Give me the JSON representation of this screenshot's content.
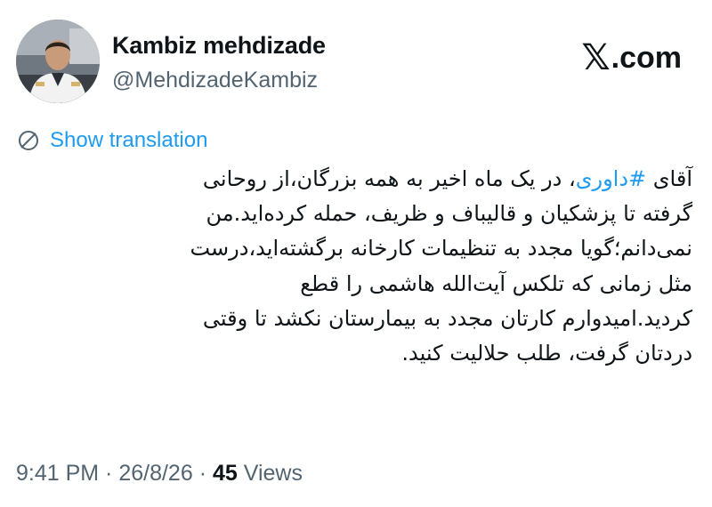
{
  "author": {
    "display_name": "Kambiz mehdizade",
    "handle": "@MehdizadeKambiz"
  },
  "brand": {
    "icon": "x-logo-icon",
    "suffix": ".com"
  },
  "translation": {
    "icon": "globe-translate-icon",
    "label": "Show translation"
  },
  "tweet": {
    "lines": [
      {
        "pre": "آقای ",
        "hashtag": "#داوری",
        "post": "، در یک ماه اخیر به همه بزرگان،از روحانی"
      },
      {
        "text": "گرفته تا پزشکیان و قالیباف و ظریف، حمله کرده‌اید.من"
      },
      {
        "text": "نمی‌دانم؛گویا مجدد به تنظیمات کارخانه برگشته‌اید،درست"
      },
      {
        "text": "مثل زمانی که تلکس آیت‌الله هاشمی را قطع"
      },
      {
        "text": "کردید.امیدوارم کارتان مجدد به بیمارستان نکشد تا وقتی"
      },
      {
        "text": "دردتان گرفت، طلب حلالیت کنید."
      }
    ]
  },
  "meta": {
    "time": "9:41 PM",
    "separator": " · ",
    "date": "26/8/26",
    "views_count": "45",
    "views_label": " Views"
  },
  "colors": {
    "link": "#1d9bf0",
    "secondary_text": "#536471",
    "primary_text": "#0f1419"
  }
}
